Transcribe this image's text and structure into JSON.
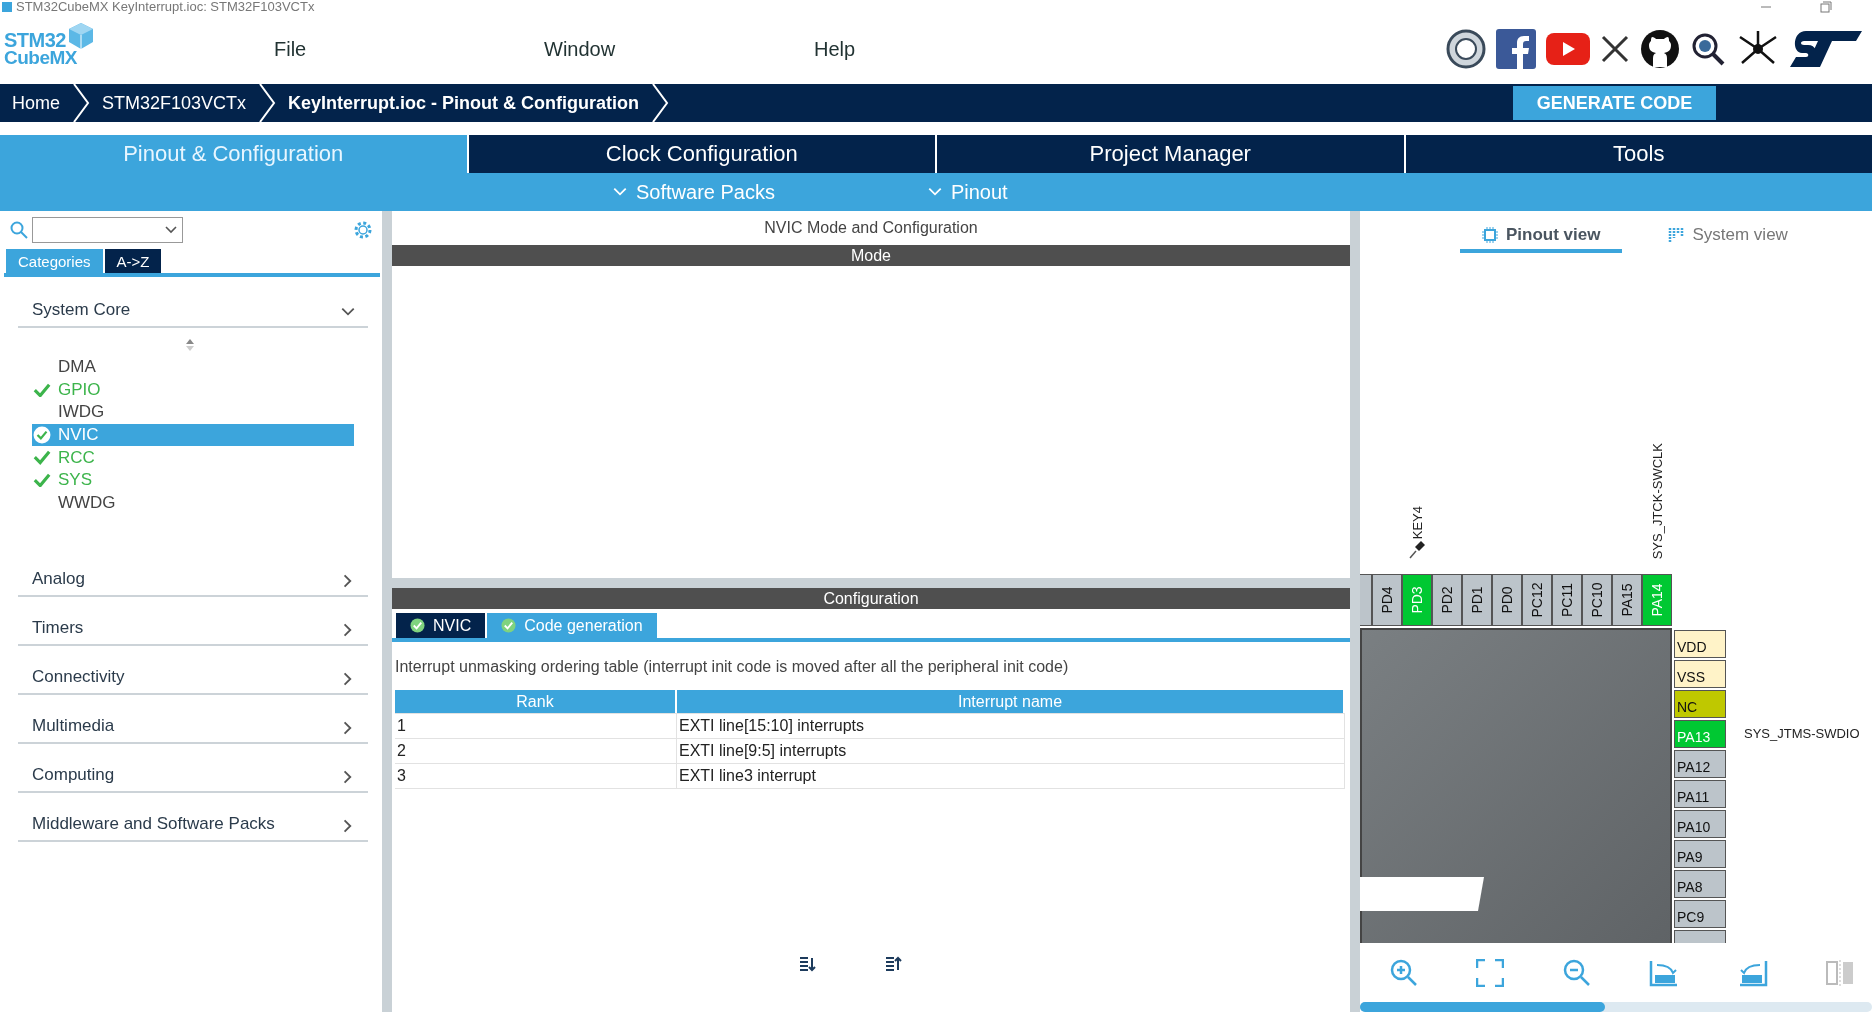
{
  "window": {
    "title": "STM32CubeMX KeyInterrupt.ioc: STM32F103VCTx"
  },
  "logo": {
    "line1": "STM32",
    "line2": "CubeMX"
  },
  "menu": [
    "File",
    "Window",
    "Help"
  ],
  "breadcrumb": [
    "Home",
    "STM32F103VCTx",
    "KeyInterrupt.ioc - Pinout & Configuration"
  ],
  "generate_button": "GENERATE CODE",
  "main_tabs": [
    {
      "label": "Pinout & Configuration",
      "selected": true
    },
    {
      "label": "Clock Configuration",
      "selected": false
    },
    {
      "label": "Project Manager",
      "selected": false
    },
    {
      "label": "Tools",
      "selected": false
    }
  ],
  "sub_menu": [
    "Software Packs",
    "Pinout"
  ],
  "sidebar": {
    "category_tabs": [
      {
        "label": "Categories",
        "selected": true
      },
      {
        "label": "A->Z",
        "selected": false
      }
    ],
    "categories": [
      {
        "label": "System Core",
        "expanded": true,
        "items": [
          {
            "label": "DMA",
            "configured": false,
            "selected": false
          },
          {
            "label": "GPIO",
            "configured": true,
            "selected": false
          },
          {
            "label": "IWDG",
            "configured": false,
            "selected": false
          },
          {
            "label": "NVIC",
            "configured": true,
            "selected": true
          },
          {
            "label": "RCC",
            "configured": true,
            "selected": false
          },
          {
            "label": "SYS",
            "configured": true,
            "selected": false
          },
          {
            "label": "WWDG",
            "configured": false,
            "selected": false
          }
        ]
      },
      {
        "label": "Analog",
        "expanded": false
      },
      {
        "label": "Timers",
        "expanded": false
      },
      {
        "label": "Connectivity",
        "expanded": false
      },
      {
        "label": "Multimedia",
        "expanded": false
      },
      {
        "label": "Computing",
        "expanded": false
      },
      {
        "label": "Middleware and Software Packs",
        "expanded": false
      }
    ]
  },
  "center": {
    "title": "NVIC Mode and Configuration",
    "mode_header": "Mode",
    "config_header": "Configuration",
    "config_tabs": [
      {
        "label": "NVIC",
        "selected": false
      },
      {
        "label": "Code generation",
        "selected": true
      }
    ],
    "description": "Interrupt unmasking ordering table (interrupt init code is moved after all the peripheral init code)",
    "table": {
      "columns": [
        "Rank",
        "Interrupt name"
      ],
      "rows": [
        [
          "1",
          "EXTI line[15:10] interrupts"
        ],
        [
          "2",
          "EXTI line[9:5] interrupts"
        ],
        [
          "3",
          "EXTI line3 interrupt"
        ]
      ]
    }
  },
  "pinout": {
    "view_tabs": [
      {
        "label": "Pinout view",
        "selected": true
      },
      {
        "label": "System view",
        "selected": false
      }
    ],
    "top_pins": [
      {
        "kind": "free"
      },
      {
        "label": "PD4",
        "kind": "free"
      },
      {
        "label": "PD3",
        "kind": "assigned",
        "signal": "KEY4",
        "pinned": true
      },
      {
        "label": "PD2",
        "kind": "free"
      },
      {
        "label": "PD1",
        "kind": "free"
      },
      {
        "label": "PD0",
        "kind": "free"
      },
      {
        "label": "PC12",
        "kind": "free"
      },
      {
        "label": "PC11",
        "kind": "free"
      },
      {
        "label": "PC10",
        "kind": "free"
      },
      {
        "label": "PA15",
        "kind": "free"
      },
      {
        "label": "PA14",
        "kind": "assigned",
        "signal": "SYS_JTCK-SWCLK"
      }
    ],
    "right_pins": [
      {
        "label": "VDD",
        "kind": "power"
      },
      {
        "label": "VSS",
        "kind": "power"
      },
      {
        "label": "NC",
        "kind": "nc"
      },
      {
        "label": "PA13",
        "kind": "assigned",
        "signal": "SYS_JTMS-SWDIO"
      },
      {
        "label": "PA12",
        "kind": "free"
      },
      {
        "label": "PA11",
        "kind": "free"
      },
      {
        "label": "PA10",
        "kind": "free"
      },
      {
        "label": "PA9",
        "kind": "free"
      },
      {
        "label": "PA8",
        "kind": "free"
      },
      {
        "label": "PC9",
        "kind": "free"
      },
      {
        "kind": "free"
      }
    ]
  }
}
